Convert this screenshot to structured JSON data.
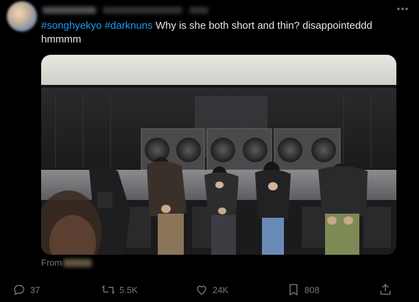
{
  "tweet": {
    "hashtag_1": "#songhyekyo",
    "hashtag_2": "#darknuns",
    "text_rest": "Why is she both short and thin? disappointeddd hmmmm"
  },
  "media": {
    "from_label": "From"
  },
  "actions": {
    "reply_count": "37",
    "retweet_count": "5.5K",
    "like_count": "24K",
    "bookmark_count": "808"
  },
  "icons": {
    "reply": "reply-icon",
    "retweet": "retweet-icon",
    "like": "heart-icon",
    "bookmark": "bookmark-icon",
    "share": "share-icon",
    "more": "more-options-icon"
  },
  "colors": {
    "hashtag": "#1d9bf0",
    "text": "#e7e9ea",
    "muted": "#71767b",
    "background": "#000000"
  }
}
